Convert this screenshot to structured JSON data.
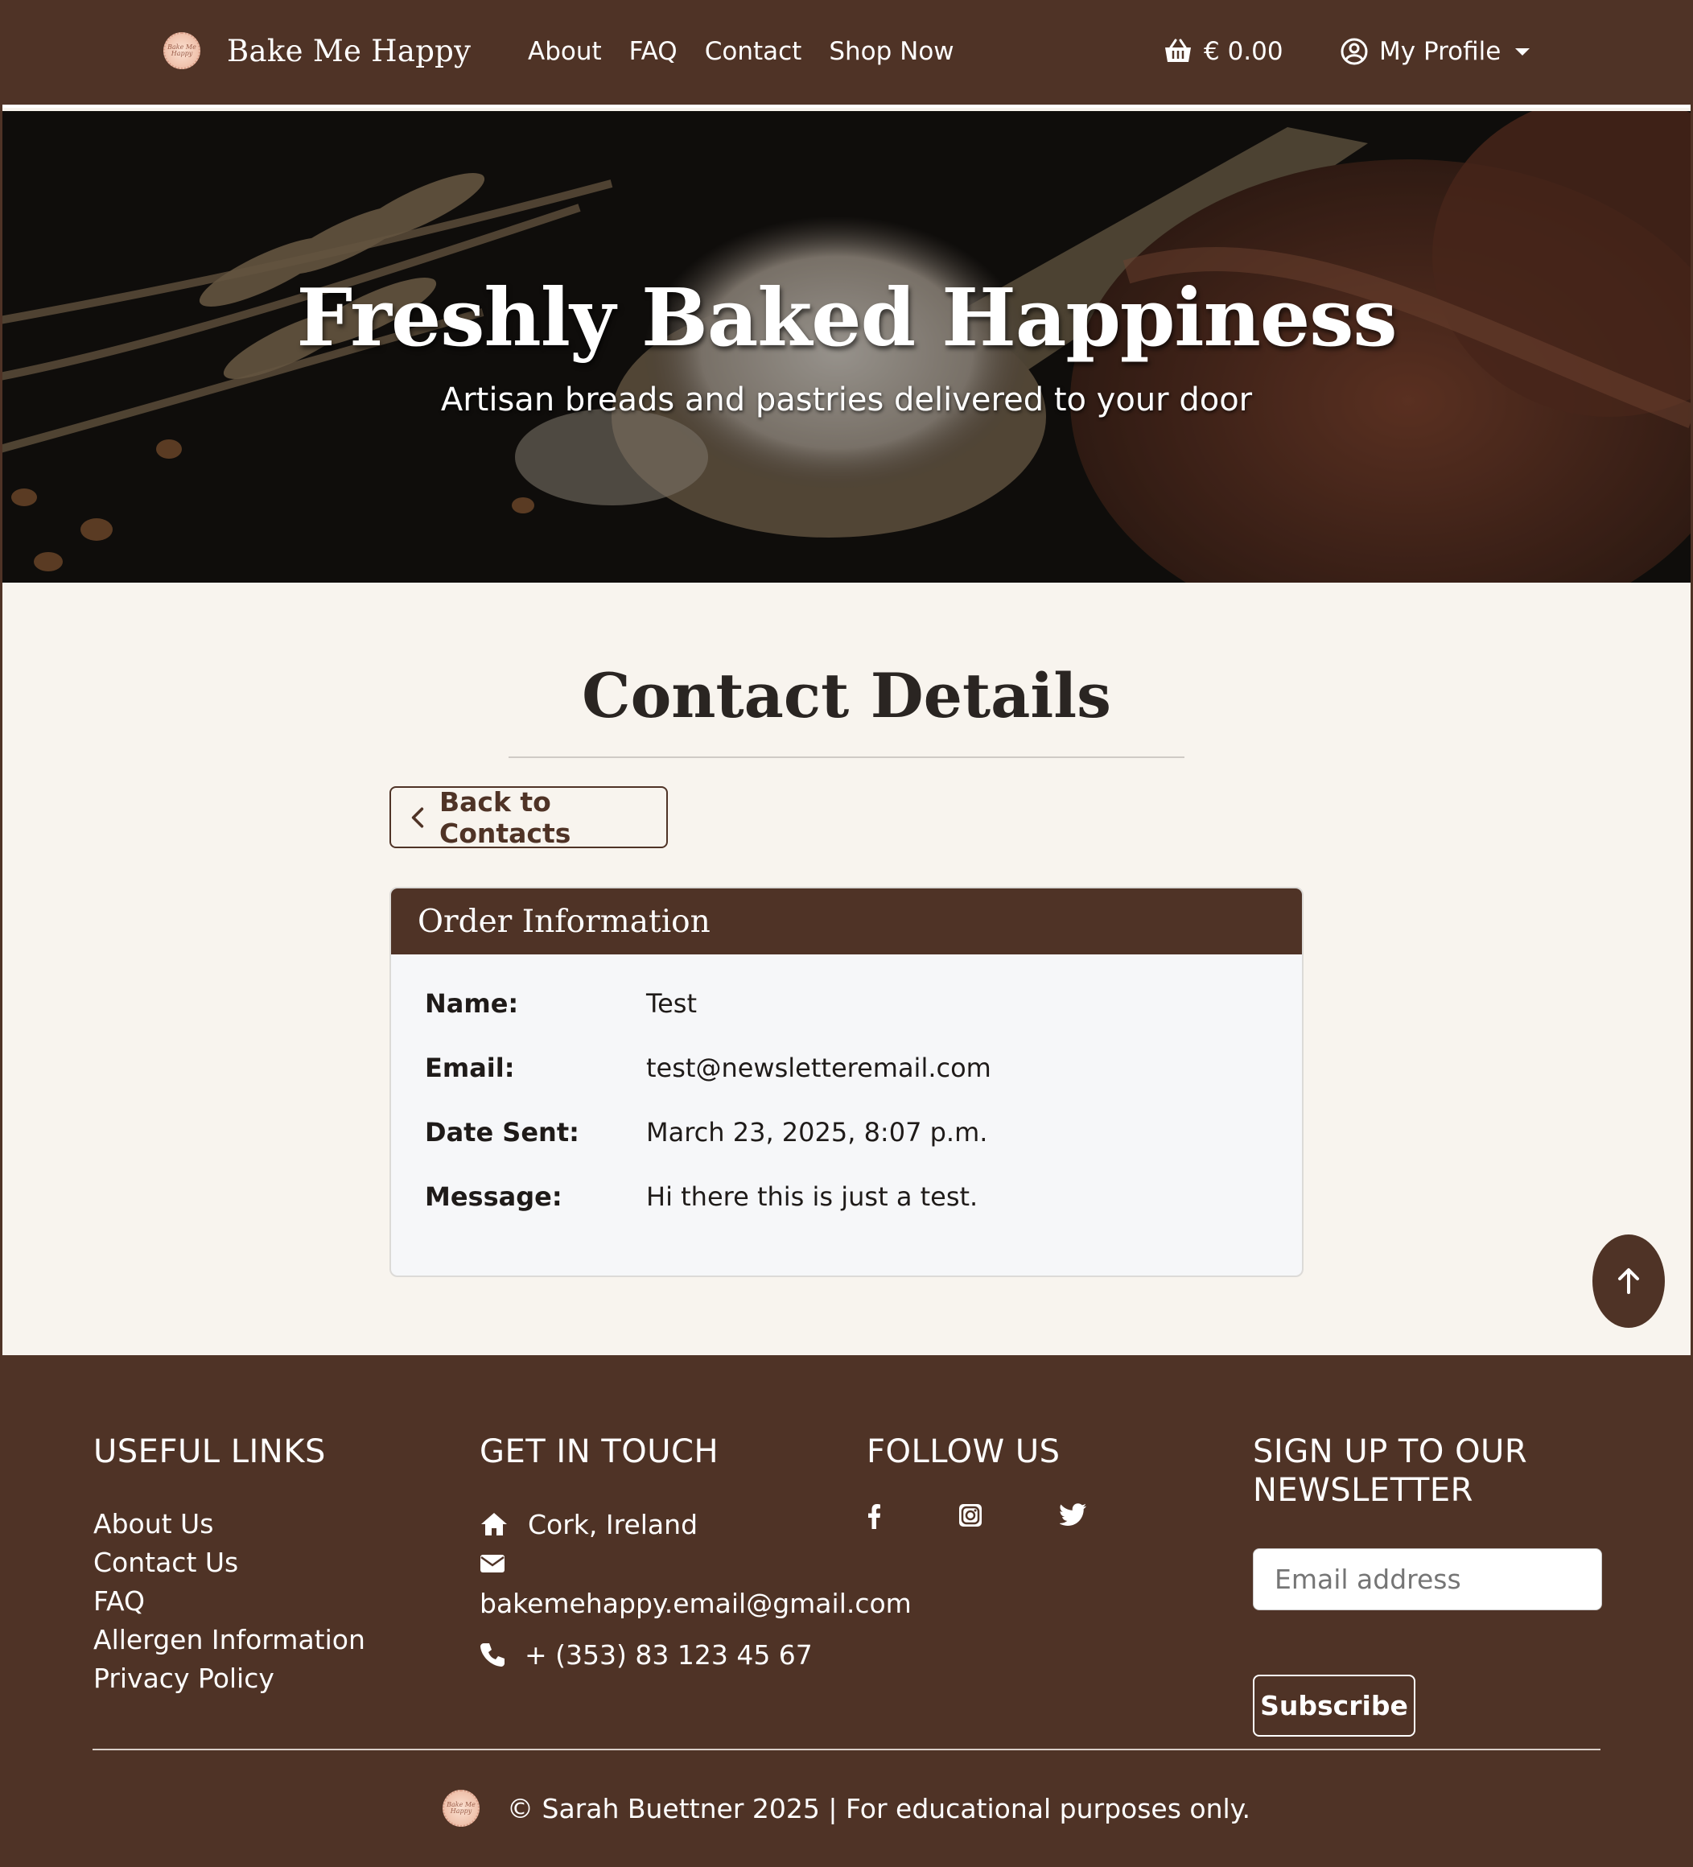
{
  "navbar": {
    "brand": "Bake Me Happy",
    "logo_text": "Bake Me Happy",
    "links": [
      "About",
      "FAQ",
      "Contact",
      "Shop Now"
    ],
    "cart_total": "€ 0.00",
    "profile_label": "My Profile",
    "icons": {
      "cart": "basket-icon",
      "profile": "user-circle-icon",
      "caret": "caret-down-icon"
    }
  },
  "hero": {
    "title": "Freshly Baked Happiness",
    "subtitle": "Artisan breads and pastries delivered to your door"
  },
  "main": {
    "title": "Contact Details",
    "back_label": "Back to Contacts",
    "card": {
      "header": "Order Information",
      "rows": [
        {
          "label": "Name:",
          "value": "Test"
        },
        {
          "label": "Email:",
          "value": "test@newsletteremail.com"
        },
        {
          "label": "Date Sent:",
          "value": "March 23, 2025, 8:07 p.m."
        },
        {
          "label": "Message:",
          "value": "Hi there this is just a test."
        }
      ]
    }
  },
  "footer": {
    "useful_links": {
      "title": "USEFUL LINKS",
      "items": [
        "About Us",
        "Contact Us",
        "FAQ",
        "Allergen Information",
        "Privacy Policy"
      ]
    },
    "get_in_touch": {
      "title": "GET IN TOUCH",
      "location": "Cork, Ireland",
      "email": "bakemehappy.email@gmail.com",
      "phone": "+ (353) 83 123 45 67"
    },
    "follow_us": {
      "title": "FOLLOW US",
      "icons": [
        "facebook-icon",
        "instagram-icon",
        "twitter-icon"
      ]
    },
    "newsletter": {
      "title_line1": "SIGN UP TO OUR",
      "title_line2": "NEWSLETTER",
      "placeholder": "Email address",
      "button": "Subscribe"
    },
    "copyright": "© Sarah Buettner 2025 | For educational purposes only."
  },
  "colors": {
    "brand_brown": "#4f3326",
    "page_background": "#f8f4ee",
    "card_background": "#f6f7f9"
  }
}
